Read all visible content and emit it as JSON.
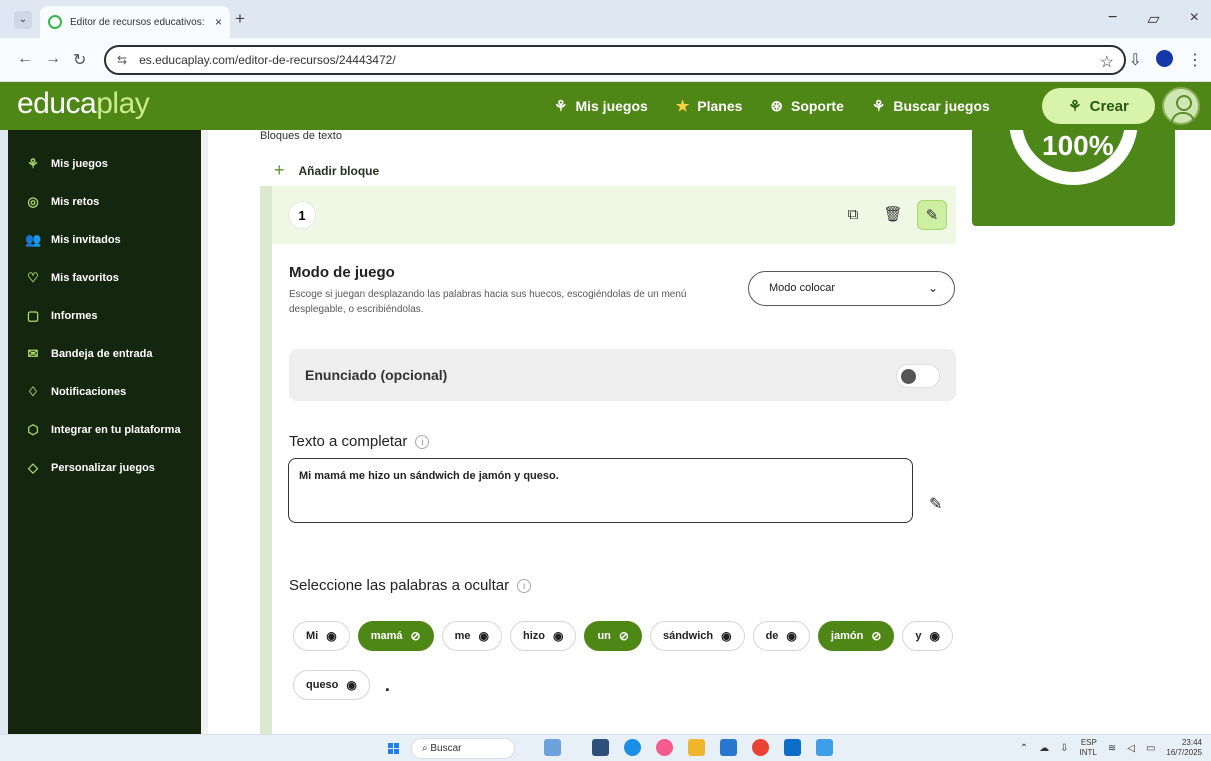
{
  "browser": {
    "tab_title": "Editor de recursos educativos: ",
    "url": "es.educaplay.com/editor-de-recursos/24443472/"
  },
  "topnav": {
    "brand_edu": "educa",
    "brand_play": "play",
    "links": [
      "Mis juegos",
      "Planes",
      "Soporte",
      "Buscar juegos"
    ],
    "create_button": "Crear"
  },
  "sidebar": {
    "items": [
      "Mis juegos",
      "Mis retos",
      "Mis invitados",
      "Mis favoritos",
      "Informes",
      "Bandeja de entrada",
      "Notificaciones",
      "Integrar en tu plataforma",
      "Personalizar juegos"
    ]
  },
  "editor": {
    "section_title": "Bloques de texto",
    "add_block": "Añadir bloque",
    "block_number": "1",
    "mode_title": "Modo de juego",
    "mode_help": "Escoge si juegan desplazando las palabras hacia sus huecos, escogiéndolas de un menú desplegable, o escribiéndolas.",
    "mode_value": "Modo colocar",
    "statement_label": "Enunciado (opcional)",
    "text_label": "Texto a completar",
    "text_value": "Mi mamá me hizo un sándwich de jamón y queso.",
    "hide_words_label": "Seleccione las palabras a ocultar",
    "words": [
      {
        "text": "Mi",
        "hidden": false
      },
      {
        "text": "mamá",
        "hidden": true
      },
      {
        "text": "me",
        "hidden": false
      },
      {
        "text": "hizo",
        "hidden": false
      },
      {
        "text": "un",
        "hidden": true
      },
      {
        "text": "sándwich",
        "hidden": false
      },
      {
        "text": "de",
        "hidden": false
      },
      {
        "text": "jamón",
        "hidden": true
      },
      {
        "text": "y",
        "hidden": false
      },
      {
        "text": "queso",
        "hidden": false
      }
    ],
    "final_punctuation": "."
  },
  "progress": {
    "label": "100%",
    "value": 100
  },
  "taskbar": {
    "search_placeholder": "Buscar",
    "language_top": "ESP",
    "language_bottom": "INTL",
    "time": "23:44",
    "date": "16/7/2025"
  },
  "colors": {
    "brand_green": "#4f8717",
    "sidebar_dark": "#15260f",
    "light_green": "#eff8e5",
    "create_green": "#d8f4aa"
  }
}
